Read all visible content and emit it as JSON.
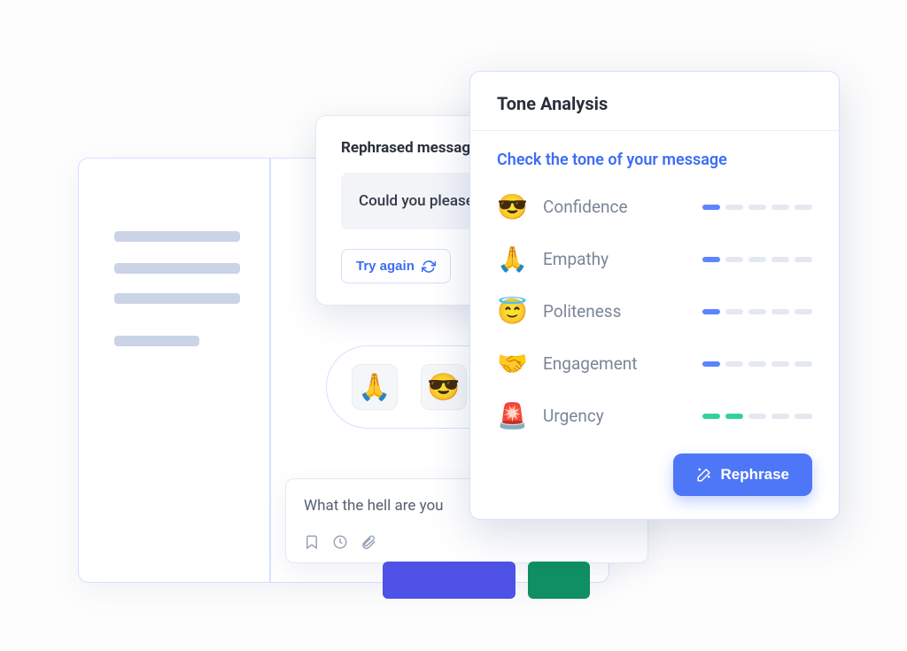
{
  "rephrased": {
    "title": "Rephrased message",
    "output": "Could you please",
    "try_again": "Try again"
  },
  "pill": {
    "emojis": [
      "🙏",
      "😎"
    ]
  },
  "compose": {
    "text": "What the hell are you"
  },
  "tone": {
    "title": "Tone Analysis",
    "subtitle": "Check the tone of your message",
    "rows": [
      {
        "emoji": "😎",
        "label": "Confidence",
        "level": 1,
        "color": "blue"
      },
      {
        "emoji": "🙏",
        "label": "Empathy",
        "level": 1,
        "color": "blue"
      },
      {
        "emoji": "😇",
        "label": "Politeness",
        "level": 1,
        "color": "blue"
      },
      {
        "emoji": "🤝",
        "label": "Engagement",
        "level": 1,
        "color": "blue"
      },
      {
        "emoji": "🚨",
        "label": "Urgency",
        "level": 2,
        "color": "green"
      }
    ],
    "rephrase_button": "Rephrase"
  }
}
